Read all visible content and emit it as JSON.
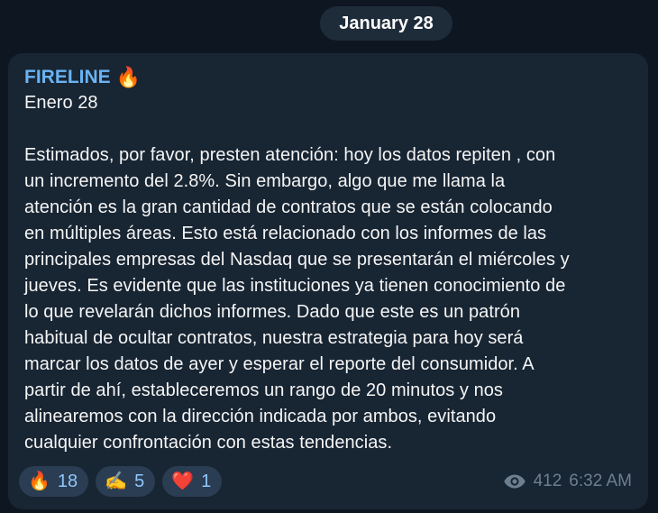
{
  "date_separator": "January 28",
  "message": {
    "channel_name": "FIRELINE",
    "channel_emoji": "🔥",
    "text": "Enero 28\n\nEstimados, por favor, presten atención: hoy los datos repiten , con\nun incremento del 2.8%. Sin embargo, algo que me llama la\natención es la gran cantidad de contratos que se están colocando\nen múltiples áreas. Esto está relacionado con los informes de las\nprincipales empresas del Nasdaq que se presentarán el miércoles y\njueves. Es evidente que las instituciones ya tienen conocimiento de\nlo que revelarán dichos informes. Dado que este es un patrón\nhabitual de ocultar contratos, nuestra estrategia para hoy será\nmarcar los datos de ayer y esperar el reporte del consumidor. A\npartir de ahí, estableceremos un rango de 20 minutos y nos\nalinearemos con la dirección indicada por ambos, evitando\ncualquier confrontación con estas tendencias.",
    "reactions": [
      {
        "emoji": "🔥",
        "icon": "fire-icon",
        "count": "18"
      },
      {
        "emoji": "✍️",
        "icon": "writing-hand-icon",
        "count": "5"
      },
      {
        "emoji": "❤️",
        "icon": "heart-icon",
        "count": "1"
      }
    ],
    "views": "412",
    "time": "6:32 AM"
  },
  "colors": {
    "background": "#0e1621",
    "bubble": "#182533",
    "channel_name": "#6ab3f3",
    "reaction_bg": "#2b3d52",
    "reaction_count": "#8ec7ff",
    "meta_text": "#6d7f8f"
  }
}
